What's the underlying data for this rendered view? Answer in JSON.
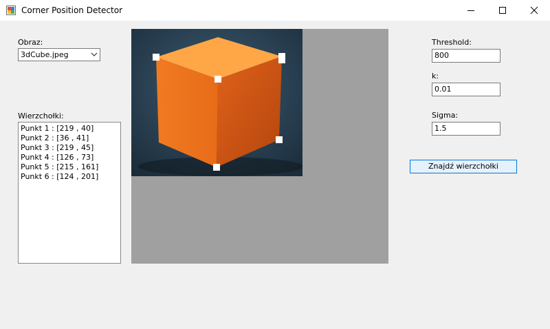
{
  "window": {
    "title": "Corner Position Detector",
    "icons": [
      "app-icon",
      "minimize-icon",
      "maximize-icon",
      "close-icon"
    ]
  },
  "left_panel": {
    "image_label": "Obraz:",
    "image_selected": "3dCube.jpeg",
    "corners_label": "Wierzchołki:",
    "corners": [
      "Punkt 1 : [219 , 40]",
      "Punkt 2 : [36 , 41]",
      "Punkt 3 : [219 , 45]",
      "Punkt 4 : [126 , 73]",
      "Punkt 5 : [215 , 161]",
      "Punkt 6 : [124 , 201]"
    ]
  },
  "params": {
    "threshold_label": "Threshold:",
    "threshold_value": "800",
    "k_label": "k:",
    "k_value": "0.01",
    "sigma_label": "Sigma:",
    "sigma_value": "1.5"
  },
  "actions": {
    "find_corners_label": "Znajdź wierzchołki"
  },
  "colors": {
    "cube": "#f57c1f",
    "background": "#f0f0f0",
    "picture_bg": "#a0a0a0",
    "accent": "#0078d7"
  }
}
